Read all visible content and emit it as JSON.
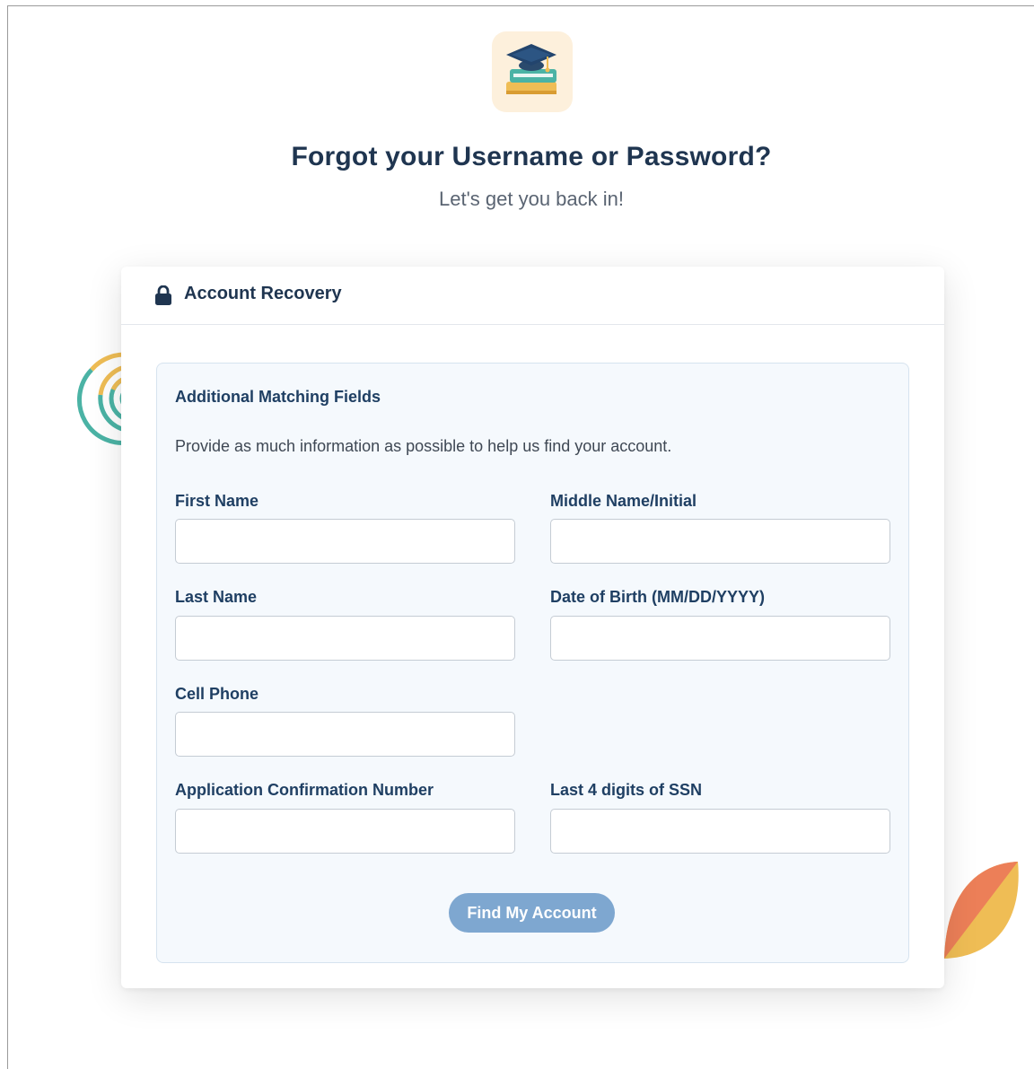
{
  "page": {
    "title": "Forgot your Username or Password?",
    "subtitle": "Let's get you back in!"
  },
  "icons": {
    "logo": "graduation-cap-books-icon",
    "lock": "lock-icon"
  },
  "card": {
    "title": "Account Recovery",
    "panel": {
      "heading": "Additional Matching Fields",
      "description": "Provide as much information as possible to help us find your account.",
      "fields": {
        "first_name": {
          "label": "First Name",
          "value": ""
        },
        "middle_name": {
          "label": "Middle Name/Initial",
          "value": ""
        },
        "last_name": {
          "label": "Last Name",
          "value": ""
        },
        "dob": {
          "label": "Date of Birth (MM/DD/YYYY)",
          "value": ""
        },
        "cell_phone": {
          "label": "Cell Phone",
          "value": ""
        },
        "confirmation": {
          "label": "Application Confirmation Number",
          "value": ""
        },
        "ssn_last4": {
          "label": "Last 4 digits of SSN",
          "value": ""
        }
      },
      "submit_label": "Find My Account"
    }
  },
  "colors": {
    "heading": "#1f3550",
    "button": "#7ea7d0",
    "panel_bg": "#f5f9fd",
    "logo_bg": "#fdf0dc",
    "deco_teal": "#4bb3a5",
    "deco_yellow": "#efbd55",
    "deco_orange": "#ec7f58"
  }
}
